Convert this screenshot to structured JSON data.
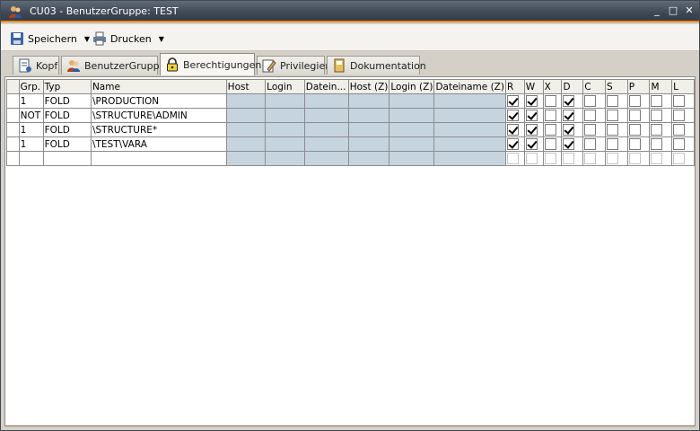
{
  "window": {
    "title": "CU03 - BenutzerGruppe: TEST",
    "minimize": "_",
    "maximize": "□",
    "close": "✕"
  },
  "toolbar": {
    "save_label": "Speichern",
    "print_label": "Drucken",
    "caret": "▼"
  },
  "tabs": [
    {
      "label": "Kopf",
      "icon": "document-icon"
    },
    {
      "label": "BenutzerGruppe",
      "icon": "users-icon"
    },
    {
      "label": "Berechtigungen",
      "icon": "lock-icon",
      "active": true
    },
    {
      "label": "Privilegien",
      "icon": "pencil-icon"
    },
    {
      "label": "Dokumentation",
      "icon": "book-icon"
    }
  ],
  "grid": {
    "headers": [
      "",
      "Grp.",
      "Typ",
      "Name",
      "Host",
      "Login",
      "Datein...",
      "Host (Z)",
      "Login (Z)",
      "Dateiname (Z)",
      "R",
      "W",
      "X",
      "D",
      "C",
      "S",
      "P",
      "M",
      "L"
    ],
    "rows": [
      {
        "grp": "1",
        "typ": "FOLD",
        "name": "\\PRODUCTION",
        "flags": [
          true,
          true,
          false,
          true,
          false,
          false,
          false,
          false,
          false
        ]
      },
      {
        "grp": "NOT",
        "typ": "FOLD",
        "name": "\\STRUCTURE\\ADMIN",
        "flags": [
          true,
          true,
          false,
          true,
          false,
          false,
          false,
          false,
          false
        ]
      },
      {
        "grp": "1",
        "typ": "FOLD",
        "name": "\\STRUCTURE*",
        "flags": [
          true,
          true,
          false,
          true,
          false,
          false,
          false,
          false,
          false
        ]
      },
      {
        "grp": "1",
        "typ": "FOLD",
        "name": "\\TEST\\VARA",
        "flags": [
          true,
          true,
          false,
          true,
          false,
          false,
          false,
          false,
          false
        ]
      }
    ]
  }
}
